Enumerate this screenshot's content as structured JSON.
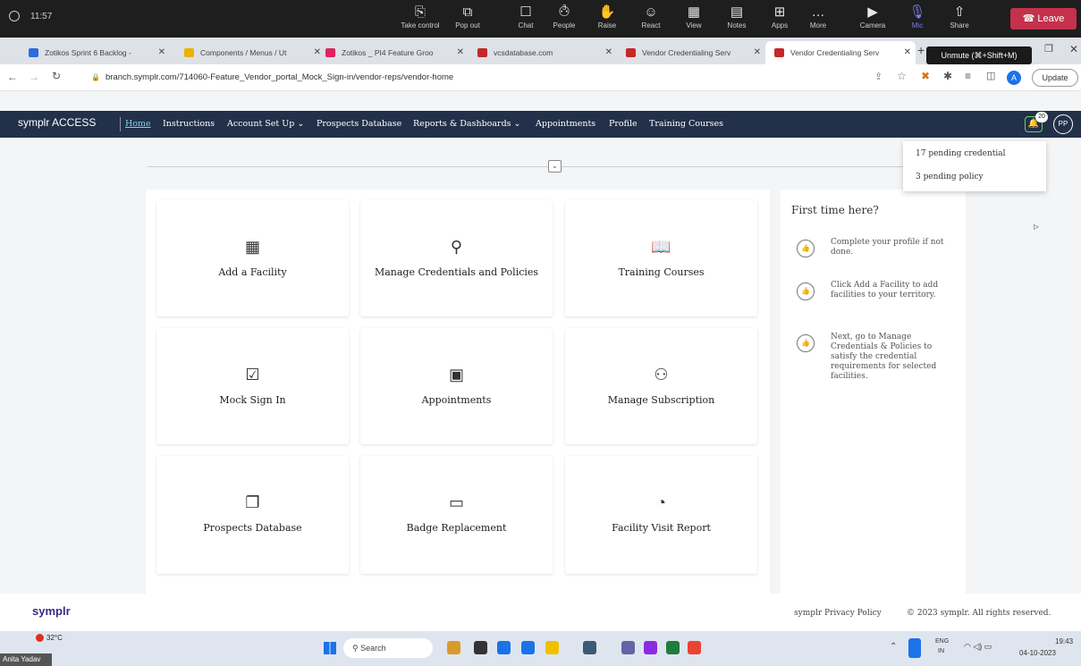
{
  "teams": {
    "time": "11:57",
    "buttons": [
      {
        "label": "Take control",
        "icon": "take-control-icon",
        "glyph": "⎘"
      },
      {
        "label": "Pop out",
        "icon": "pop-out-icon",
        "glyph": "⧉"
      },
      {
        "label": "Chat",
        "icon": "chat-icon",
        "glyph": "☐"
      },
      {
        "label": "People",
        "icon": "people-icon",
        "glyph": "⚇"
      },
      {
        "label": "Raise",
        "icon": "raise-hand-icon",
        "glyph": "✋"
      },
      {
        "label": "React",
        "icon": "react-icon",
        "glyph": "☺"
      },
      {
        "label": "View",
        "icon": "view-icon",
        "glyph": "▦"
      },
      {
        "label": "Notes",
        "icon": "notes-icon",
        "glyph": "▤"
      },
      {
        "label": "Apps",
        "icon": "apps-icon",
        "glyph": "⊞"
      },
      {
        "label": "More",
        "icon": "more-icon",
        "glyph": "…"
      },
      {
        "label": "Camera",
        "icon": "camera-off-icon",
        "glyph": "▶"
      },
      {
        "label": "Mic",
        "icon": "mic-off-icon",
        "glyph": "🎙"
      },
      {
        "label": "Share",
        "icon": "share-icon",
        "glyph": "⇧"
      }
    ],
    "people_count": "3",
    "leave_label": "Leave",
    "tooltip": "Unmute (⌘+Shift+M)"
  },
  "browser": {
    "tabs": [
      {
        "title": "Zotikos Sprint 6 Backlog -",
        "color": "#2d6cdf"
      },
      {
        "title": "Components / Menus / Ut",
        "color": "#e8b400"
      },
      {
        "title": "Zotikos _ PI4 Feature Groo",
        "color": "#e0245e"
      },
      {
        "title": "vcsdatabase.com",
        "color": "#c62828"
      },
      {
        "title": "Vendor Credentialing Serv",
        "color": "#c62828"
      },
      {
        "title": "Vendor Credentialing Serv",
        "color": "#c62828"
      }
    ],
    "url": "branch.symplr.com/714060-Feature_Vendor_portal_Mock_Sign-in/vendor-reps/vendor-home",
    "update_label": "Update",
    "profile_initial": "A"
  },
  "app": {
    "logo": "symplr ACCESS",
    "nav": [
      "Home",
      "Instructions",
      "Account Set Up ⌄",
      "Prospects Database",
      "Reports & Dashboards ⌄",
      "Appointments",
      "Profile",
      "Training Courses"
    ],
    "notif_count": "20",
    "user_initials": "PP",
    "notifications": [
      "17 pending credential",
      "3 pending policy"
    ],
    "cards": [
      {
        "label": "Add a Facility",
        "icon": "building-icon",
        "glyph": "▦"
      },
      {
        "label": "Manage Credentials and Policies",
        "icon": "user-check-icon",
        "glyph": "⚲"
      },
      {
        "label": "Training Courses",
        "icon": "book-icon",
        "glyph": "📖"
      },
      {
        "label": "Mock Sign In",
        "icon": "file-check-icon",
        "glyph": "☑"
      },
      {
        "label": "Appointments",
        "icon": "calendar-icon",
        "glyph": "▣"
      },
      {
        "label": "Manage Subscription",
        "icon": "users-icon",
        "glyph": "⚇"
      },
      {
        "label": "Prospects Database",
        "icon": "copy-icon",
        "glyph": "❐"
      },
      {
        "label": "Badge Replacement",
        "icon": "badge-card-icon",
        "glyph": "▭"
      },
      {
        "label": "Facility Visit Report",
        "icon": "pie-chart-icon",
        "glyph": "◔"
      }
    ],
    "first_time": {
      "title": "First time here?",
      "steps": [
        "Complete your profile if not done.",
        "Click Add a Facility to add facilities to your territory.",
        "Next, go to Manage Credentials & Policies to satisfy the credential requirements for selected facilities."
      ]
    },
    "footer": {
      "logo": "symplr",
      "privacy": "symplr Privacy Policy",
      "copyright": "© 2023 symplr. All rights reserved."
    }
  },
  "taskbar": {
    "weather": "32°C",
    "user": "Anita Yadav",
    "search": "Search",
    "lang1": "ENG",
    "lang2": "IN",
    "time": "19:43",
    "date": "04-10-2023"
  }
}
